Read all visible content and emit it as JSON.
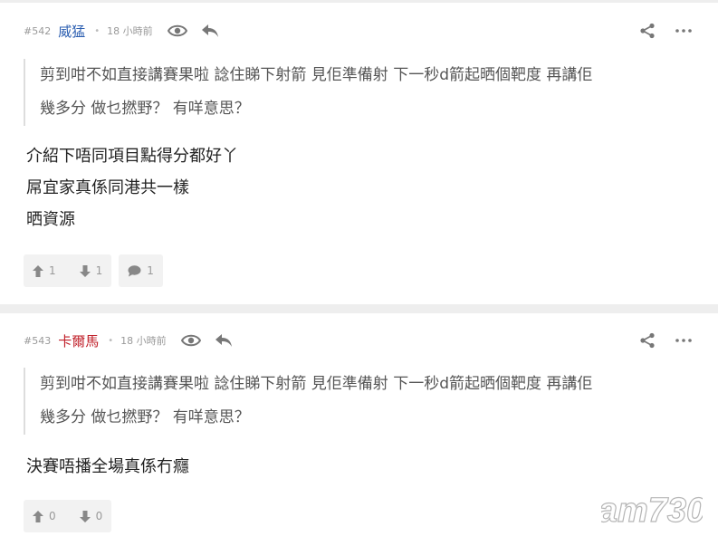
{
  "posts": [
    {
      "number": "#542",
      "username": "威猛",
      "user_color": "#2a5db0",
      "time": "18 小時前",
      "quote": [
        "剪到咁不如直接講賽果啦 諗住睇下射箭 見佢準備射 下一秒d箭起晒個靶度 再講佢",
        "幾多分 做乜撚野？ 有咩意思？"
      ],
      "lines": [
        "介紹下唔同項目點得分都好丫",
        "屌宜家真係同港共一樣",
        "晒資源"
      ],
      "upvotes": "1",
      "downvotes": "1",
      "replies": "1"
    },
    {
      "number": "#543",
      "username": "卡爾馬",
      "user_color": "#c0202a",
      "time": "18 小時前",
      "quote": [
        "剪到咁不如直接講賽果啦 諗住睇下射箭 見佢準備射 下一秒d箭起晒個靶度 再講佢",
        "幾多分 做乜撚野？ 有咩意思？"
      ],
      "lines": [
        "決賽唔播全場真係冇癮"
      ],
      "upvotes": "0",
      "downvotes": "0"
    }
  ],
  "watermark": "am730",
  "colors": {
    "icon": "#777777",
    "vote_bg": "#f2f2f2",
    "separator": "#eeeeee"
  }
}
